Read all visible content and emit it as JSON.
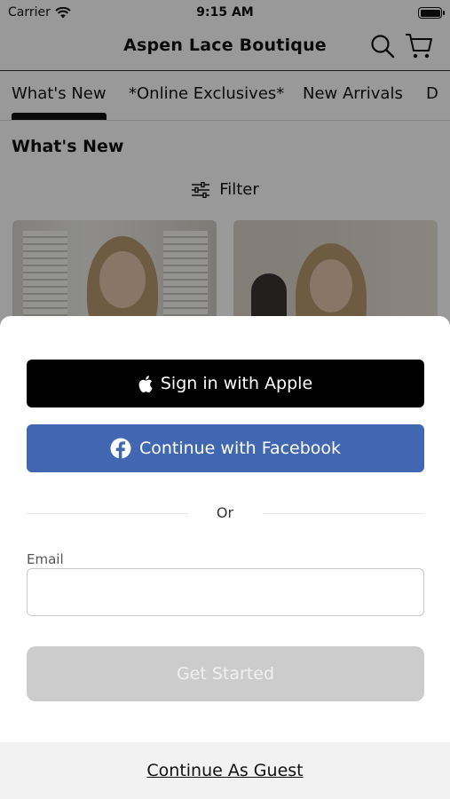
{
  "status_bar": {
    "carrier": "Carrier",
    "time": "9:15 AM",
    "icons": [
      "wifi-icon",
      "battery-icon"
    ]
  },
  "nav": {
    "title": "Aspen Lace Boutique",
    "icons": [
      "search-icon",
      "cart-icon"
    ]
  },
  "tabs": [
    {
      "label": "What's New",
      "active": true
    },
    {
      "label": "*Online Exclusives*",
      "active": false
    },
    {
      "label": "New Arrivals",
      "active": false
    },
    {
      "label": "D",
      "active": false
    }
  ],
  "section": {
    "title": "What's New",
    "filter_label": "Filter",
    "filter_icon": "sliders-icon"
  },
  "sheet": {
    "apple_button": "Sign in with Apple",
    "facebook_button": "Continue with Facebook",
    "divider_text": "Or",
    "email_label": "Email",
    "email_value": "",
    "submit_button": "Get Started",
    "guest_link": "Continue As Guest"
  },
  "colors": {
    "facebook_blue": "#4267b2",
    "apple_black": "#000000",
    "disabled_button": "#cccccc",
    "overlay": "rgba(0,0,0,0.4)"
  }
}
